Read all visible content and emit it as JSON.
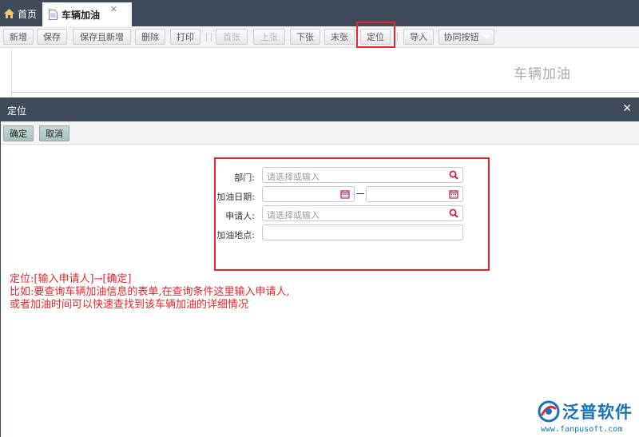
{
  "tabs": {
    "home_label": "首页",
    "active_label": "车辆加油",
    "close_glyph": "✕"
  },
  "toolbar": {
    "buttons": [
      {
        "label": "新增",
        "disabled": false
      },
      {
        "label": "保存",
        "disabled": false
      },
      {
        "label": "保存且新增",
        "disabled": false
      },
      {
        "label": "删除",
        "disabled": false
      },
      {
        "label": "打印",
        "disabled": false
      },
      {
        "label": "首张",
        "disabled": true
      },
      {
        "label": "上张",
        "disabled": true
      },
      {
        "label": "下张",
        "disabled": false
      },
      {
        "label": "末张",
        "disabled": false
      },
      {
        "label": "定位",
        "disabled": false
      },
      {
        "label": "导入",
        "disabled": false
      },
      {
        "label": "协同按钮",
        "disabled": false
      }
    ]
  },
  "background_form": {
    "title": "车辆加油"
  },
  "dialog": {
    "title": "定位",
    "close_glyph": "✕",
    "confirm_label": "确定",
    "cancel_label": "取消",
    "fields": {
      "department": {
        "label": "部门:",
        "placeholder": "请选择或输入"
      },
      "refuel_date": {
        "label": "加油日期:"
      },
      "applicant": {
        "label": "申请人:",
        "placeholder": "请选择或输入"
      },
      "refuel_location": {
        "label": "加油地点:"
      }
    }
  },
  "annotation": {
    "line1": "定位:[输入申请人]→[确定]",
    "line2": "比如:要查询车辆加油信息的表单,在查询条件这里输入申请人,",
    "line3": "或者加油时间可以快速查找到该车辆加油的详细情况"
  },
  "logo": {
    "name": "泛普软件",
    "url": "www.fanpusoft.com"
  },
  "colors": {
    "header_bg": "#3f4b5a",
    "highlight_red": "#e8262a",
    "dialog_button_bg": "#b4cac7",
    "logo_blue": "#1a72bb"
  }
}
